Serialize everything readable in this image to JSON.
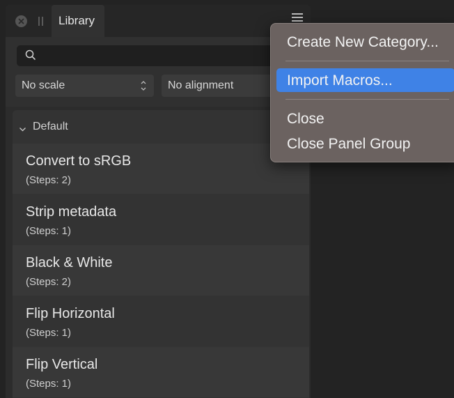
{
  "panel": {
    "tab_label": "Library",
    "search": {
      "value": "",
      "placeholder": ""
    },
    "scale_select": "No scale",
    "alignment_select": "No alignment"
  },
  "category": {
    "label": "Default",
    "expanded": true
  },
  "macros": [
    {
      "name": "Convert to sRGB",
      "steps": "(Steps: 2)"
    },
    {
      "name": "Strip metadata",
      "steps": "(Steps: 1)"
    },
    {
      "name": "Black & White",
      "steps": "(Steps: 2)"
    },
    {
      "name": "Flip Horizontal",
      "steps": "(Steps: 1)"
    },
    {
      "name": "Flip Vertical",
      "steps": "(Steps: 1)"
    }
  ],
  "context_menu": {
    "items": [
      {
        "label": "Create New Category...",
        "highlighted": false
      },
      {
        "label": "Import Macros...",
        "highlighted": true
      },
      {
        "label": "Close",
        "highlighted": false
      },
      {
        "label": "Close Panel Group",
        "highlighted": false
      }
    ]
  },
  "icons": {
    "close": "close-icon",
    "grip": "drag-handle-icon",
    "menu": "hamburger-menu-icon",
    "search": "search-icon",
    "stepper": "up-down-chevron-icon",
    "category": "chevron-down-icon"
  },
  "colors": {
    "menu_highlight": "#3f82e6",
    "menu_background": "#6b6260",
    "panel_background": "#2c2c2c"
  }
}
